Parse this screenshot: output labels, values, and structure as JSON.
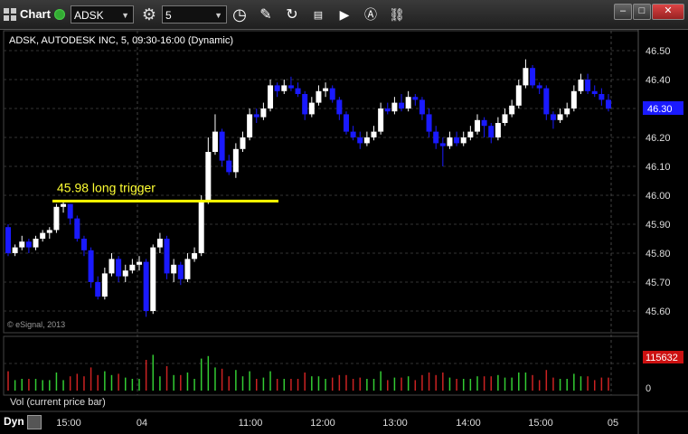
{
  "window": {
    "title": "Chart",
    "symbol": "ADSK",
    "interval": "5"
  },
  "chart": {
    "header": "ADSK, AUTODESK INC, 5, 09:30-16:00 (Dynamic)",
    "annotation": "45.98 long trigger",
    "watermark": "© eSignal, 2013",
    "price_label": "46.30",
    "volume_label": "115632",
    "volume_panel_label": "Vol (current price bar)",
    "volume_zero": "0",
    "dyn_label": "Dyn",
    "colors": {
      "up": "#ffffff",
      "down": "#1a1aff",
      "trigger": "#ffff00",
      "vol_up": "#33cc33",
      "vol_down": "#cc2222",
      "price_tag": "#1a1aff",
      "vol_tag": "#cc1111"
    }
  },
  "chart_data": {
    "type": "candlestick",
    "y_ticks": [
      "46.50",
      "46.40",
      "46.30",
      "46.20",
      "46.10",
      "46.00",
      "45.90",
      "45.80",
      "45.70",
      "45.60"
    ],
    "x_ticks": [
      "15:00",
      "04",
      "11:00",
      "12:00",
      "13:00",
      "14:00",
      "15:00",
      "05"
    ],
    "ylim": [
      45.55,
      46.55
    ],
    "trigger_price": 45.98,
    "candles": [
      [
        45.89,
        45.8,
        45.9,
        45.79
      ],
      [
        45.8,
        45.82,
        45.83,
        45.79
      ],
      [
        45.82,
        45.84,
        45.86,
        45.81
      ],
      [
        45.84,
        45.82,
        45.85,
        45.8
      ],
      [
        45.82,
        45.85,
        45.86,
        45.81
      ],
      [
        45.85,
        45.87,
        45.88,
        45.84
      ],
      [
        45.87,
        45.88,
        45.89,
        45.85
      ],
      [
        45.88,
        45.96,
        45.97,
        45.87
      ],
      [
        45.96,
        45.97,
        45.98,
        45.94
      ],
      [
        45.97,
        45.92,
        45.97,
        45.9
      ],
      [
        45.92,
        45.85,
        45.93,
        45.84
      ],
      [
        45.85,
        45.81,
        45.86,
        45.79
      ],
      [
        45.81,
        45.7,
        45.82,
        45.68
      ],
      [
        45.7,
        45.65,
        45.72,
        45.64
      ],
      [
        45.65,
        45.73,
        45.75,
        45.64
      ],
      [
        45.73,
        45.78,
        45.8,
        45.72
      ],
      [
        45.78,
        45.72,
        45.79,
        45.7
      ],
      [
        45.72,
        45.74,
        45.76,
        45.7
      ],
      [
        45.74,
        45.76,
        45.78,
        45.73
      ],
      [
        45.76,
        45.77,
        45.79,
        45.74
      ],
      [
        45.77,
        45.6,
        45.78,
        45.58
      ],
      [
        45.6,
        45.82,
        45.83,
        45.59
      ],
      [
        45.82,
        45.85,
        45.87,
        45.8
      ],
      [
        45.85,
        45.73,
        45.86,
        45.71
      ],
      [
        45.73,
        45.76,
        45.78,
        45.7
      ],
      [
        45.76,
        45.71,
        45.77,
        45.69
      ],
      [
        45.71,
        45.78,
        45.8,
        45.7
      ],
      [
        45.78,
        45.8,
        45.82,
        45.77
      ],
      [
        45.8,
        45.98,
        46.0,
        45.79
      ],
      [
        45.98,
        46.15,
        46.2,
        45.97
      ],
      [
        46.15,
        46.22,
        46.28,
        46.14
      ],
      [
        46.22,
        46.12,
        46.23,
        46.1
      ],
      [
        46.12,
        46.08,
        46.14,
        46.07
      ],
      [
        46.08,
        46.16,
        46.18,
        46.06
      ],
      [
        46.16,
        46.2,
        46.22,
        46.15
      ],
      [
        46.2,
        46.28,
        46.3,
        46.19
      ],
      [
        46.28,
        46.27,
        46.3,
        46.25
      ],
      [
        46.27,
        46.3,
        46.32,
        46.26
      ],
      [
        46.3,
        46.38,
        46.4,
        46.29
      ],
      [
        46.38,
        46.36,
        46.39,
        46.34
      ],
      [
        46.36,
        46.38,
        46.4,
        46.35
      ],
      [
        46.38,
        46.37,
        46.41,
        46.36
      ],
      [
        46.37,
        46.35,
        46.39,
        46.34
      ],
      [
        46.35,
        46.28,
        46.36,
        46.26
      ],
      [
        46.28,
        46.32,
        46.34,
        46.27
      ],
      [
        46.32,
        46.36,
        46.38,
        46.31
      ],
      [
        46.36,
        46.37,
        46.39,
        46.34
      ],
      [
        46.37,
        46.33,
        46.38,
        46.32
      ],
      [
        46.33,
        46.28,
        46.34,
        46.26
      ],
      [
        46.28,
        46.22,
        46.29,
        46.21
      ],
      [
        46.22,
        46.2,
        46.24,
        46.19
      ],
      [
        46.2,
        46.18,
        46.22,
        46.16
      ],
      [
        46.18,
        46.2,
        46.22,
        46.17
      ],
      [
        46.2,
        46.22,
        46.24,
        46.19
      ],
      [
        46.22,
        46.3,
        46.32,
        46.21
      ],
      [
        46.3,
        46.29,
        46.32,
        46.28
      ],
      [
        46.29,
        46.32,
        46.34,
        46.28
      ],
      [
        46.32,
        46.3,
        46.35,
        46.29
      ],
      [
        46.3,
        46.34,
        46.36,
        46.29
      ],
      [
        46.34,
        46.33,
        46.35,
        46.31
      ],
      [
        46.33,
        46.28,
        46.34,
        46.26
      ],
      [
        46.28,
        46.22,
        46.3,
        46.2
      ],
      [
        46.22,
        46.18,
        46.24,
        46.16
      ],
      [
        46.18,
        46.17,
        46.2,
        46.1
      ],
      [
        46.17,
        46.2,
        46.22,
        46.16
      ],
      [
        46.2,
        46.18,
        46.22,
        46.17
      ],
      [
        46.18,
        46.2,
        46.22,
        46.17
      ],
      [
        46.2,
        46.22,
        46.24,
        46.19
      ],
      [
        46.22,
        46.26,
        46.28,
        46.21
      ],
      [
        46.26,
        46.24,
        46.27,
        46.2
      ],
      [
        46.24,
        46.2,
        46.25,
        46.18
      ],
      [
        46.2,
        46.25,
        46.27,
        46.19
      ],
      [
        46.25,
        46.28,
        46.3,
        46.24
      ],
      [
        46.28,
        46.31,
        46.33,
        46.27
      ],
      [
        46.31,
        46.38,
        46.4,
        46.3
      ],
      [
        46.38,
        46.44,
        46.47,
        46.37
      ],
      [
        46.44,
        46.38,
        46.45,
        46.37
      ],
      [
        46.38,
        46.37,
        46.39,
        46.35
      ],
      [
        46.37,
        46.28,
        46.38,
        46.26
      ],
      [
        46.28,
        46.26,
        46.29,
        46.23
      ],
      [
        46.26,
        46.28,
        46.3,
        46.25
      ],
      [
        46.28,
        46.3,
        46.32,
        46.27
      ],
      [
        46.3,
        46.36,
        46.38,
        46.29
      ],
      [
        46.36,
        46.4,
        46.42,
        46.35
      ],
      [
        46.4,
        46.36,
        46.42,
        46.35
      ],
      [
        46.36,
        46.35,
        46.38,
        46.34
      ],
      [
        46.35,
        46.33,
        46.37,
        46.31
      ],
      [
        46.33,
        46.3,
        46.35,
        46.29
      ]
    ]
  }
}
